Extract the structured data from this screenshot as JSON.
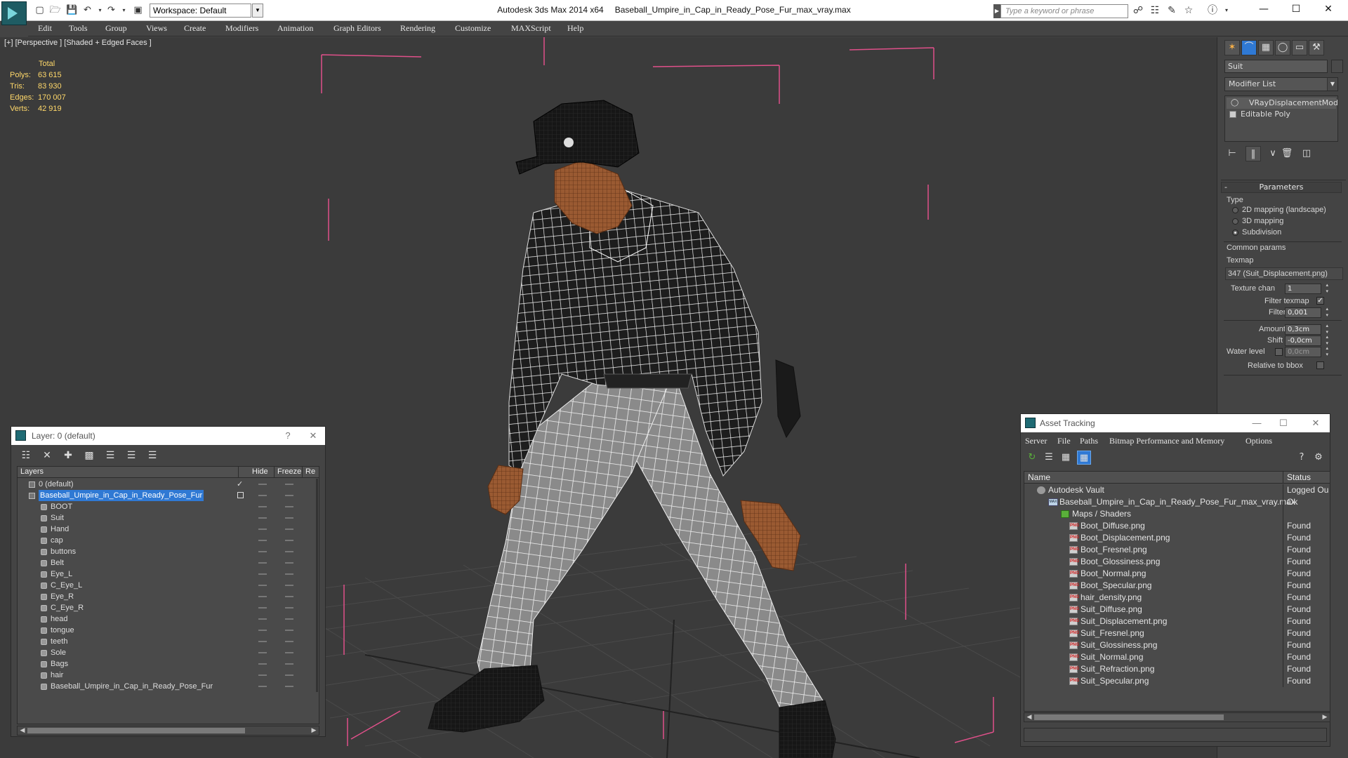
{
  "app": {
    "name": "Autodesk 3ds Max  2014 x64",
    "file": "Baseball_Umpire_in_Cap_in_Ready_Pose_Fur_max_vray.max",
    "workspace": "Workspace: Default",
    "search_placeholder": "Type a keyword or phrase"
  },
  "menu": [
    "Edit",
    "Tools",
    "Group",
    "Views",
    "Create",
    "Modifiers",
    "Animation",
    "Graph Editors",
    "Rendering",
    "Customize",
    "MAXScript",
    "Help"
  ],
  "viewport": {
    "label": "[+] [Perspective ] [Shaded + Edged Faces ]",
    "stats_title": "Total",
    "stats": [
      {
        "label": "Polys:",
        "value": "63 615"
      },
      {
        "label": "Tris:",
        "value": "83 930"
      },
      {
        "label": "Edges:",
        "value": "170 007"
      },
      {
        "label": "Verts:",
        "value": "42 919"
      }
    ]
  },
  "command_panel": {
    "object_name": "Suit",
    "modifier_list": "Modifier List",
    "stack": [
      "VRayDisplacementMod",
      "Editable Poly"
    ],
    "parameters_title": "Parameters",
    "type_label": "Type",
    "type_options": [
      "2D mapping (landscape)",
      "3D mapping",
      "Subdivision"
    ],
    "type_selected": "Subdivision",
    "common_params": "Common params",
    "texmap_label": "Texmap",
    "texmap_value": "347 (Suit_Displacement.png)",
    "texture_chan_label": "Texture chan",
    "texture_chan_value": "1",
    "filter_texmap_label": "Filter texmap",
    "filter_texmap_checked": true,
    "filter_blur_label": "Filter blur",
    "filter_blur_value": "0,001",
    "amount_label": "Amount",
    "amount_value": "0,3cm",
    "shift_label": "Shift",
    "shift_value": "-0,0cm",
    "water_level_label": "Water level",
    "water_level_value": "0,0cm",
    "relative_bbox_label": "Relative to bbox"
  },
  "layer_panel": {
    "title": "Layer: 0 (default)",
    "help": "?",
    "columns": [
      "Layers",
      "Hide",
      "Freeze",
      "Re"
    ],
    "rows": [
      {
        "name": "0 (default)",
        "level": 0,
        "type": "layer",
        "current": true
      },
      {
        "name": "Baseball_Umpire_in_Cap_in_Ready_Pose_Fur",
        "level": 0,
        "type": "layer",
        "selected": true
      },
      {
        "name": "BOOT",
        "level": 1,
        "type": "object"
      },
      {
        "name": "Suit",
        "level": 1,
        "type": "object"
      },
      {
        "name": "Hand",
        "level": 1,
        "type": "object"
      },
      {
        "name": "cap",
        "level": 1,
        "type": "object"
      },
      {
        "name": "buttons",
        "level": 1,
        "type": "object"
      },
      {
        "name": "Belt",
        "level": 1,
        "type": "object"
      },
      {
        "name": "Eye_L",
        "level": 1,
        "type": "object"
      },
      {
        "name": "C_Eye_L",
        "level": 1,
        "type": "object"
      },
      {
        "name": "Eye_R",
        "level": 1,
        "type": "object"
      },
      {
        "name": "C_Eye_R",
        "level": 1,
        "type": "object"
      },
      {
        "name": "head",
        "level": 1,
        "type": "object"
      },
      {
        "name": "tongue",
        "level": 1,
        "type": "object"
      },
      {
        "name": "teeth",
        "level": 1,
        "type": "object"
      },
      {
        "name": "Sole",
        "level": 1,
        "type": "object"
      },
      {
        "name": "Bags",
        "level": 1,
        "type": "object"
      },
      {
        "name": "hair",
        "level": 1,
        "type": "object"
      },
      {
        "name": "Baseball_Umpire_in_Cap_in_Ready_Pose_Fur",
        "level": 1,
        "type": "object"
      }
    ]
  },
  "asset_panel": {
    "title": "Asset Tracking",
    "menu": [
      "Server",
      "File",
      "Paths",
      "Bitmap Performance and Memory",
      "Options"
    ],
    "columns": [
      "Name",
      "Status"
    ],
    "rows": [
      {
        "name": "Autodesk Vault",
        "status": "Logged Ou",
        "level": 0,
        "kind": "vault"
      },
      {
        "name": "Baseball_Umpire_in_Cap_in_Ready_Pose_Fur_max_vray.max",
        "status": "Ok",
        "level": 1,
        "kind": "max"
      },
      {
        "name": "Maps / Shaders",
        "status": "",
        "level": 2,
        "kind": "maps"
      },
      {
        "name": "Boot_Diffuse.png",
        "status": "Found",
        "level": 3,
        "kind": "png"
      },
      {
        "name": "Boot_Displacement.png",
        "status": "Found",
        "level": 3,
        "kind": "png"
      },
      {
        "name": "Boot_Fresnel.png",
        "status": "Found",
        "level": 3,
        "kind": "png"
      },
      {
        "name": "Boot_Glossiness.png",
        "status": "Found",
        "level": 3,
        "kind": "png"
      },
      {
        "name": "Boot_Normal.png",
        "status": "Found",
        "level": 3,
        "kind": "png"
      },
      {
        "name": "Boot_Specular.png",
        "status": "Found",
        "level": 3,
        "kind": "png"
      },
      {
        "name": "hair_density.png",
        "status": "Found",
        "level": 3,
        "kind": "png"
      },
      {
        "name": "Suit_Diffuse.png",
        "status": "Found",
        "level": 3,
        "kind": "png"
      },
      {
        "name": "Suit_Displacement.png",
        "status": "Found",
        "level": 3,
        "kind": "png"
      },
      {
        "name": "Suit_Fresnel.png",
        "status": "Found",
        "level": 3,
        "kind": "png"
      },
      {
        "name": "Suit_Glossiness.png",
        "status": "Found",
        "level": 3,
        "kind": "png"
      },
      {
        "name": "Suit_Normal.png",
        "status": "Found",
        "level": 3,
        "kind": "png"
      },
      {
        "name": "Suit_Refraction.png",
        "status": "Found",
        "level": 3,
        "kind": "png"
      },
      {
        "name": "Suit_Specular.png",
        "status": "Found",
        "level": 3,
        "kind": "png"
      }
    ]
  },
  "colors": {
    "viewport_bg": "#3b3b3b",
    "ui_bg": "#444444",
    "selection": "#2f79d4",
    "stats": "#ffd86a",
    "bbox": "#e0508a"
  }
}
